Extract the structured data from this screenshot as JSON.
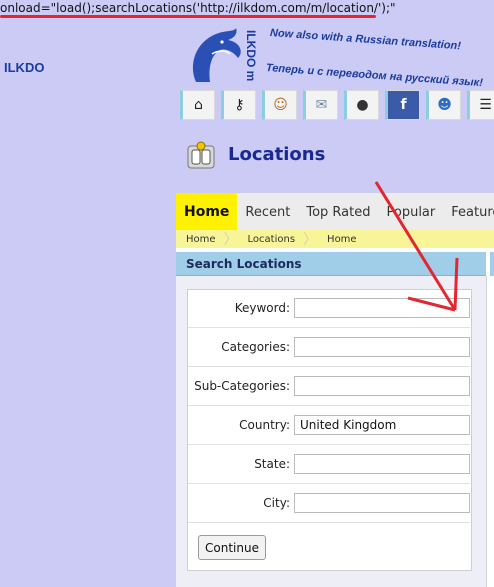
{
  "code_snippet": "onload=\"load();searchLocations('http://ilkdom.com/m/location/');\"",
  "branding": {
    "logo_text": "ILKDO",
    "logo_vertical": "ILKDO m",
    "tagline_en": "Now also with a Russian translation!",
    "tagline_ru": "Теперь и с переводом на русский язык!"
  },
  "icon_bar": [
    {
      "name": "home-icon",
      "glyph": "⌂"
    },
    {
      "name": "keyhole-icon",
      "glyph": "⚷"
    },
    {
      "name": "user-icon",
      "glyph": "☺"
    },
    {
      "name": "mail-icon",
      "glyph": "✉"
    },
    {
      "name": "ball-icon",
      "glyph": "●"
    },
    {
      "name": "facebook-icon",
      "glyph": "f"
    },
    {
      "name": "group-icon",
      "glyph": "☻"
    },
    {
      "name": "document-icon",
      "glyph": "☰"
    }
  ],
  "page": {
    "title": "Locations"
  },
  "tabs": [
    "Home",
    "Recent",
    "Top Rated",
    "Popular",
    "Featured"
  ],
  "breadcrumbs": [
    "Home",
    "Locations",
    "Home"
  ],
  "search": {
    "heading": "Search Locations",
    "fields": [
      {
        "label": "Keyword:",
        "value": ""
      },
      {
        "label": "Categories:",
        "value": ""
      },
      {
        "label": "Sub-Categories:",
        "value": ""
      },
      {
        "label": "Country:",
        "value": "United Kingdom"
      },
      {
        "label": "State:",
        "value": ""
      },
      {
        "label": "City:",
        "value": ""
      }
    ],
    "submit_label": "Continue"
  },
  "colors": {
    "background": "#cccbf5",
    "accent_tab": "#fff200",
    "title": "#182a8f",
    "annotation": "#e3262f"
  }
}
